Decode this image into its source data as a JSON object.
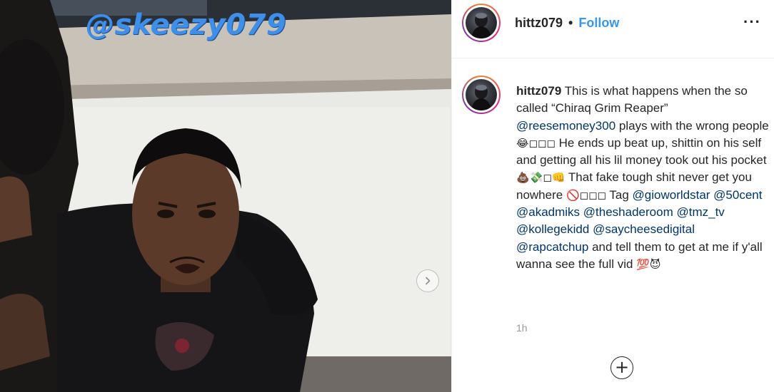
{
  "post": {
    "sticker_text": "@skeezy079",
    "next_icon": "chevron-right-icon"
  },
  "header": {
    "username": "hittz079",
    "separator": "•",
    "follow_label": "Follow",
    "more_label": "···"
  },
  "caption": {
    "username": "hittz079",
    "parts": {
      "t1": " This is what happens when the so called “Chiraq Grim Reaper” ",
      "m1": "@reesemoney300",
      "t2": " plays with the wrong people ",
      "e1": "😂◻◻◻",
      "t3": " He ends up beat up, shittin on his self and getting all his lil money took out his pocket ",
      "e2": "💩💸◻👊",
      "t4": " That fake tough shit never get you nowhere ",
      "e3": "🚫◻◻◻",
      "t5": " Tag ",
      "m2": "@gioworldstar",
      "s1": " ",
      "m3": "@50cent",
      "s2": " ",
      "m4": "@akadmiks",
      "s3": " ",
      "m5": "@theshaderoom",
      "s4": " ",
      "m6": "@tmz_tv",
      "s5": " ",
      "m7": "@kollegekidd",
      "s6": " ",
      "m8": "@saycheesedigital",
      "s7": " ",
      "m9": "@rapcatchup",
      "t6": " and tell them to get at me if y'all wanna see the full vid ",
      "e4": "💯😈"
    },
    "time": "1h"
  },
  "actions": {
    "add_label": "+"
  },
  "colors": {
    "link": "#3897f0",
    "mention": "#003569",
    "sticker": "#3f8fe8",
    "ring": "#dd2a7b"
  }
}
